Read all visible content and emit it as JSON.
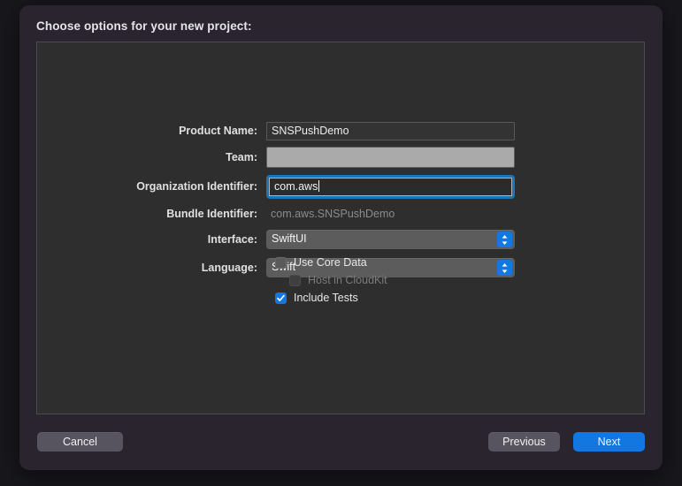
{
  "dialog": {
    "title": "Choose options for your new project:"
  },
  "form": {
    "rows": [
      {
        "label": "Product Name:",
        "value": "SNSPushDemo",
        "type": "textfield"
      },
      {
        "label": "Team:",
        "value": "",
        "type": "teamfield"
      },
      {
        "label": "Organization Identifier:",
        "value": "com.aws",
        "type": "textfield-focused"
      },
      {
        "label": "Bundle Identifier:",
        "value": "com.aws.SNSPushDemo",
        "type": "static"
      },
      {
        "label": "Interface:",
        "value": "SwiftUI",
        "type": "popup"
      },
      {
        "label": "Language:",
        "value": "Swift",
        "type": "popup"
      }
    ]
  },
  "checkboxes": [
    {
      "label": "Use Core Data",
      "checked": false,
      "disabled": false,
      "indent": false
    },
    {
      "label": "Host in CloudKit",
      "checked": false,
      "disabled": true,
      "indent": true
    },
    {
      "label": "Include Tests",
      "checked": true,
      "disabled": false,
      "indent": false
    }
  ],
  "buttons": {
    "cancel": "Cancel",
    "previous": "Previous",
    "next": "Next"
  },
  "colors": {
    "accent": "#1277e0",
    "focus_ring": "#1b76b8",
    "dialog_bg": "#29242e",
    "panel_bg": "#2e2e2e",
    "backdrop": "#18171c"
  }
}
